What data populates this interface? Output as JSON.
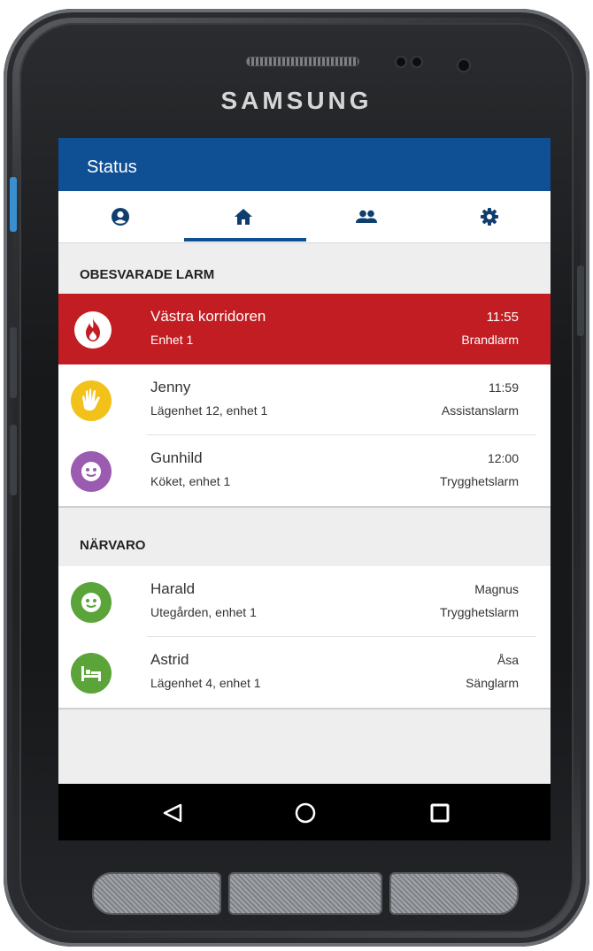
{
  "device": {
    "brand": "SAMSUNG"
  },
  "appbar": {
    "title": "Status"
  },
  "tabs": [
    {
      "icon": "account-icon",
      "selected": false
    },
    {
      "icon": "home-icon",
      "selected": true
    },
    {
      "icon": "people-icon",
      "selected": false
    },
    {
      "icon": "gear-icon",
      "selected": false
    }
  ],
  "sections": {
    "unanswered": {
      "header": "OBESVARADE LARM",
      "items": [
        {
          "name": "Västra korridoren",
          "location": "Enhet 1",
          "time": "11:55",
          "type": "Brandlarm",
          "icon": "fire-icon",
          "color": "#c21d22"
        },
        {
          "name": "Jenny",
          "location": "Lägenhet 12, enhet 1",
          "time": "11:59",
          "type": "Assistanslarm",
          "icon": "hand-icon",
          "color": "#f2c21b"
        },
        {
          "name": "Gunhild",
          "location": "Köket, enhet 1",
          "time": "12:00",
          "type": "Trygghetslarm",
          "icon": "face-icon",
          "color": "#9a5bb1"
        }
      ]
    },
    "presence": {
      "header": "NÄRVARO",
      "items": [
        {
          "name": "Harald",
          "location": "Utegården, enhet 1",
          "staff": "Magnus",
          "type": "Trygghetslarm",
          "icon": "face-icon",
          "color": "#5aa43a"
        },
        {
          "name": "Astrid",
          "location": "Lägenhet 4, enhet 1",
          "staff": "Åsa",
          "type": "Sänglarm",
          "icon": "bed-icon",
          "color": "#5aa43a"
        }
      ]
    }
  },
  "navbar": {
    "buttons": [
      "back-icon",
      "home-circle-icon",
      "recents-icon"
    ]
  },
  "colors": {
    "primary": "#0f4f93",
    "alarm": "#c21d22",
    "background": "#eeeeee"
  }
}
